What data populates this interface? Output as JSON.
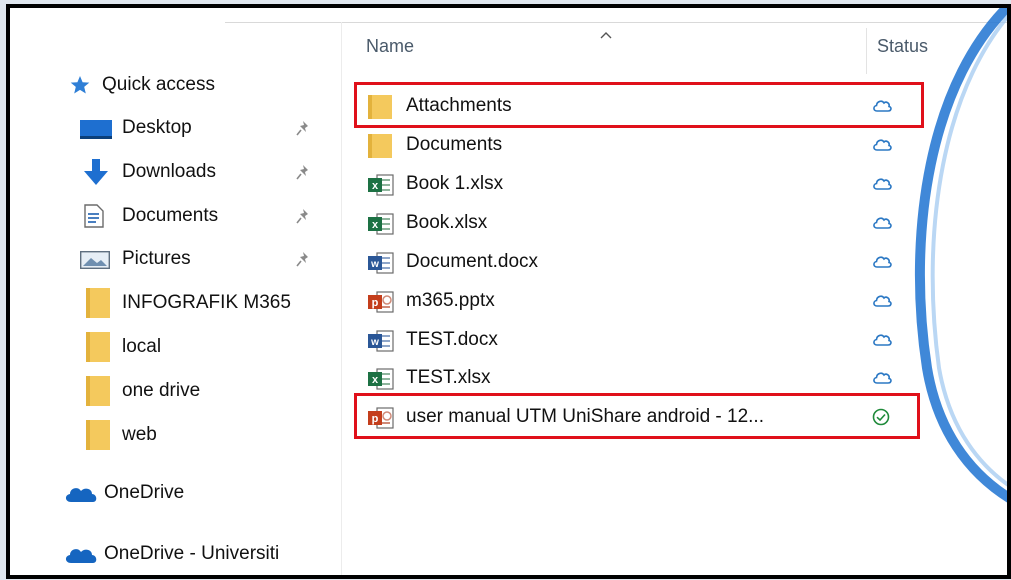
{
  "columns": {
    "name": "Name",
    "status": "Status"
  },
  "sidebar": {
    "quick_access": "Quick access",
    "items": [
      {
        "label": "Desktop",
        "icon": "desktop-icon",
        "pinned": true
      },
      {
        "label": "Downloads",
        "icon": "downloads-icon",
        "pinned": true
      },
      {
        "label": "Documents",
        "icon": "documents-icon",
        "pinned": true
      },
      {
        "label": "Pictures",
        "icon": "pictures-icon",
        "pinned": true
      },
      {
        "label": "INFOGRAFIK M365",
        "icon": "folder-icon",
        "pinned": false
      },
      {
        "label": "local",
        "icon": "folder-icon",
        "pinned": false
      },
      {
        "label": "one drive",
        "icon": "folder-icon",
        "pinned": false
      },
      {
        "label": "web",
        "icon": "folder-icon",
        "pinned": false
      }
    ],
    "onedrive": "OneDrive",
    "onedrive_org": "OneDrive - Universiti"
  },
  "files": [
    {
      "name": "Attachments",
      "type": "folder",
      "status": "cloud",
      "highlighted": true
    },
    {
      "name": "Documents",
      "type": "folder",
      "status": "cloud",
      "highlighted": false
    },
    {
      "name": "Book 1.xlsx",
      "type": "excel",
      "status": "cloud",
      "highlighted": false
    },
    {
      "name": "Book.xlsx",
      "type": "excel",
      "status": "cloud",
      "highlighted": false
    },
    {
      "name": "Document.docx",
      "type": "word",
      "status": "cloud",
      "highlighted": false
    },
    {
      "name": "m365.pptx",
      "type": "powerpoint",
      "status": "cloud",
      "highlighted": false
    },
    {
      "name": "TEST.docx",
      "type": "word",
      "status": "cloud",
      "highlighted": false
    },
    {
      "name": "TEST.xlsx",
      "type": "excel",
      "status": "cloud",
      "highlighted": false
    },
    {
      "name": "user manual UTM UniShare  android - 12...",
      "type": "powerpoint",
      "status": "synced",
      "highlighted": true
    }
  ],
  "colors": {
    "highlight": "#e0101a",
    "cloud_status": "#2b78c4",
    "synced_status": "#1f8a3a",
    "folder": "#f4c95d",
    "excel": "#1d7144",
    "word": "#2b5797",
    "powerpoint": "#c43e1c"
  }
}
